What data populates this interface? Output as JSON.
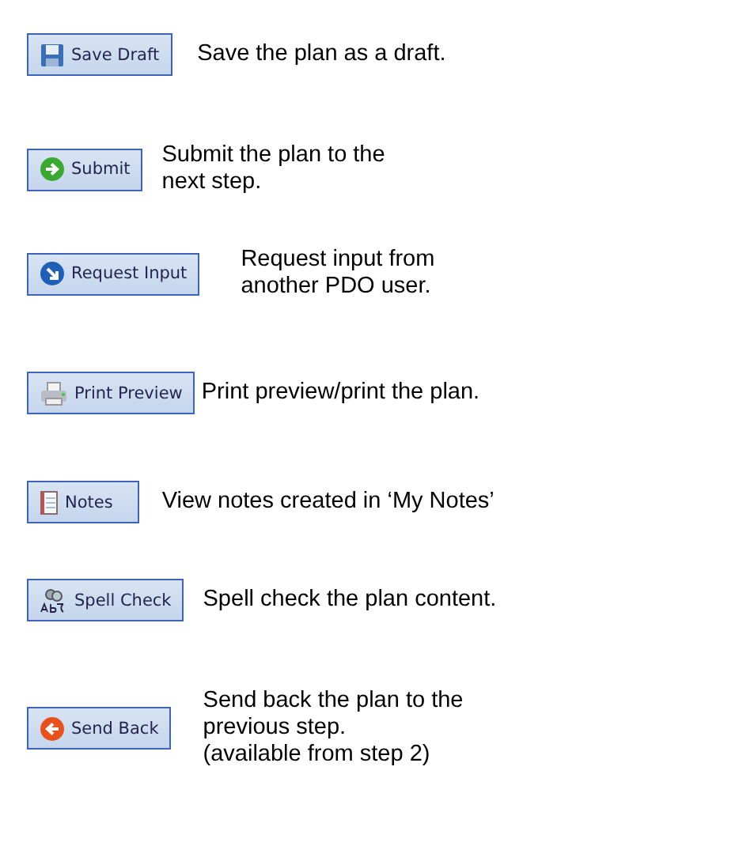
{
  "actions": [
    {
      "kind": "save",
      "label": "Save Draft",
      "description": [
        "Save the plan as a draft."
      ]
    },
    {
      "kind": "submit",
      "label": "Submit",
      "description": [
        "Submit the plan to the",
        "next step."
      ]
    },
    {
      "kind": "request",
      "label": "Request Input",
      "description": [
        "Request input from",
        "another PDO user."
      ]
    },
    {
      "kind": "print",
      "label": "Print Preview",
      "description": [
        "Print preview/print the plan."
      ]
    },
    {
      "kind": "notes",
      "label": "Notes",
      "description": [
        "View notes created in ‘My Notes’"
      ]
    },
    {
      "kind": "spell",
      "label": "Spell Check",
      "description": [
        "Spell check the plan content."
      ]
    },
    {
      "kind": "sendback",
      "label": "Send Back",
      "description": [
        "Send back the plan to the",
        "previous step.",
        "(available from step 2)"
      ]
    }
  ]
}
